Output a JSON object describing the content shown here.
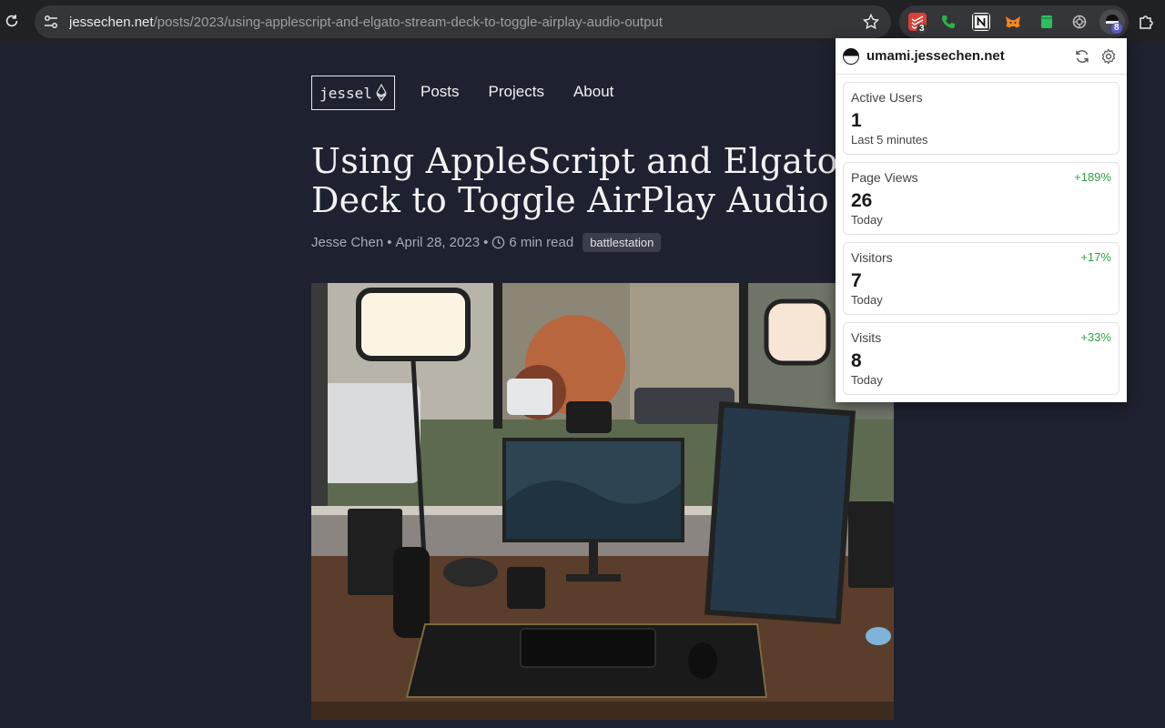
{
  "browser": {
    "url_host": "jessechen.net",
    "url_path": "/posts/2023/using-applescript-and-elgato-stream-deck-to-toggle-airplay-audio-output",
    "extensions": [
      {
        "name": "todoist-icon",
        "color": "#db4035",
        "badge": "3"
      },
      {
        "name": "phone-icon",
        "color": "#2fb344"
      },
      {
        "name": "notion-icon",
        "color": "#ffffff"
      },
      {
        "name": "metamask-icon",
        "color": "#f6851b"
      },
      {
        "name": "evernote-icon",
        "color": "#2dbe60"
      },
      {
        "name": "openai-icon",
        "color": "#bdbdbd"
      },
      {
        "name": "umami-icon",
        "color": "#111111",
        "badge": "8"
      }
    ]
  },
  "site": {
    "logo_text": "jessel",
    "nav": [
      "Posts",
      "Projects",
      "About"
    ]
  },
  "post": {
    "title_line1": "Using AppleScript and Elgato Stream",
    "title_line2": "Deck to Toggle AirPlay Audio Output",
    "author": "Jesse Chen",
    "date": "April 28, 2023",
    "read_time": "6 min read",
    "tag": "battlestation",
    "separator": "•"
  },
  "popup": {
    "site": "umami.jessechen.net",
    "stats": [
      {
        "label": "Active Users",
        "value": "1",
        "sub": "Last 5 minutes",
        "change": ""
      },
      {
        "label": "Page Views",
        "value": "26",
        "sub": "Today",
        "change": "+189%"
      },
      {
        "label": "Visitors",
        "value": "7",
        "sub": "Today",
        "change": "+17%"
      },
      {
        "label": "Visits",
        "value": "8",
        "sub": "Today",
        "change": "+33%"
      }
    ]
  }
}
